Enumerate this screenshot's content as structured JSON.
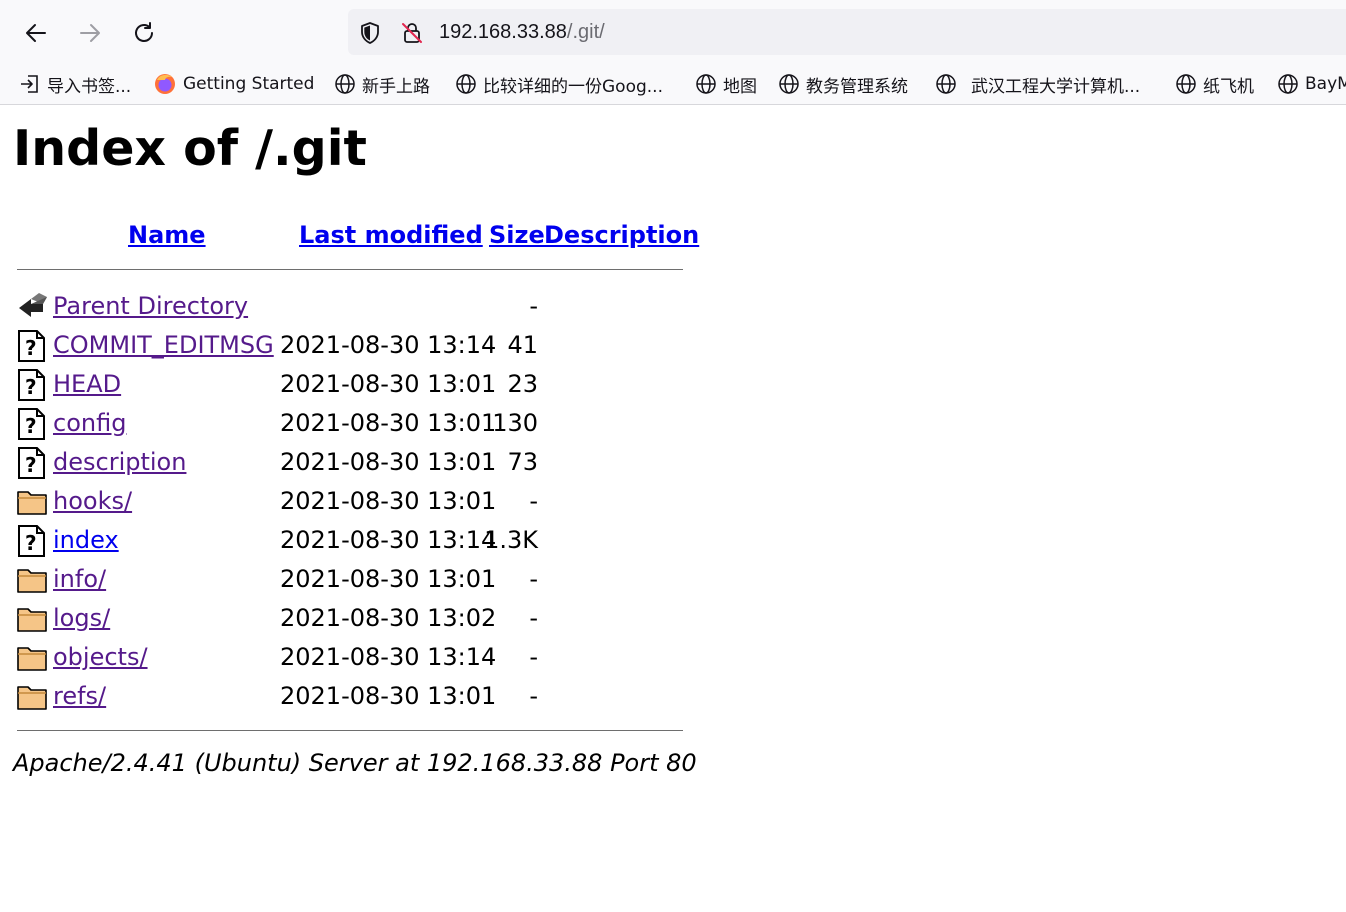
{
  "browser": {
    "url_host": "192.168.33.88",
    "url_path": "/.git/",
    "bookmarks": [
      {
        "label": "导入书签...",
        "icon": "import-icon"
      },
      {
        "label": "Getting Started",
        "icon": "firefox-icon"
      },
      {
        "label": "新手上路",
        "icon": "globe-icon"
      },
      {
        "label": "比较详细的一份Goog...",
        "icon": "globe-icon"
      },
      {
        "label": "地图",
        "icon": "globe-icon"
      },
      {
        "label": "教务管理系统",
        "icon": "globe-icon"
      },
      {
        "label": "武汉工程大学计算机...",
        "icon": "globe-icon"
      },
      {
        "label": "纸飞机",
        "icon": "globe-icon"
      },
      {
        "label": "BayM",
        "icon": "globe-icon"
      }
    ]
  },
  "page": {
    "title": "Index of /.git",
    "columns": {
      "name": "Name",
      "last_modified": "Last modified",
      "size": "Size",
      "description": "Description"
    },
    "entries": [
      {
        "name": "Parent Directory",
        "modified": "",
        "size": "-",
        "icon": "back-icon"
      },
      {
        "name": "COMMIT_EDITMSG",
        "modified": "2021-08-30 13:14",
        "size": "41",
        "icon": "unknown-file-icon"
      },
      {
        "name": "HEAD",
        "modified": "2021-08-30 13:01",
        "size": "23",
        "icon": "unknown-file-icon"
      },
      {
        "name": "config",
        "modified": "2021-08-30 13:01",
        "size": "130",
        "icon": "unknown-file-icon"
      },
      {
        "name": "description",
        "modified": "2021-08-30 13:01",
        "size": "73",
        "icon": "unknown-file-icon"
      },
      {
        "name": "hooks/",
        "modified": "2021-08-30 13:01",
        "size": "-",
        "icon": "folder-icon"
      },
      {
        "name": "index",
        "modified": "2021-08-30 13:14",
        "size": "1.3K",
        "icon": "unknown-file-icon"
      },
      {
        "name": "info/",
        "modified": "2021-08-30 13:01",
        "size": "-",
        "icon": "folder-icon"
      },
      {
        "name": "logs/",
        "modified": "2021-08-30 13:02",
        "size": "-",
        "icon": "folder-icon"
      },
      {
        "name": "objects/",
        "modified": "2021-08-30 13:14",
        "size": "-",
        "icon": "folder-icon"
      },
      {
        "name": "refs/",
        "modified": "2021-08-30 13:01",
        "size": "-",
        "icon": "folder-icon"
      }
    ],
    "footer": "Apache/2.4.41 (Ubuntu) Server at 192.168.33.88 Port 80"
  }
}
